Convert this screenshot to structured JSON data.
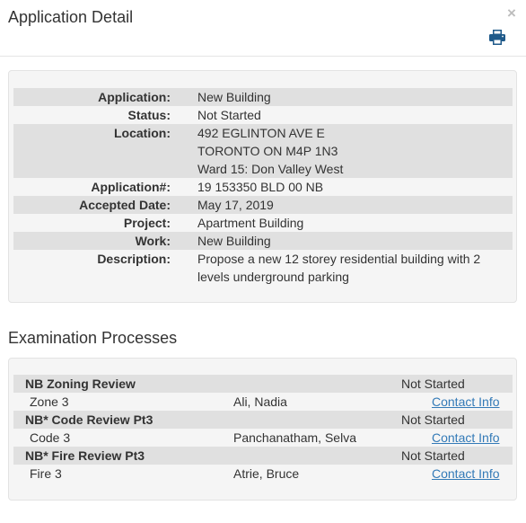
{
  "modal": {
    "title": "Application Detail",
    "close_glyph": "×",
    "print_icon": "print-icon",
    "close_icon": "close-icon"
  },
  "details": [
    {
      "label": "Application:",
      "value": "New Building"
    },
    {
      "label": "Status:",
      "value": "Not Started"
    },
    {
      "label": "Location:",
      "lines": [
        "492 EGLINTON AVE E",
        "TORONTO ON M4P 1N3",
        "Ward 15: Don Valley West"
      ]
    },
    {
      "label": "Application#:",
      "value": "19 153350 BLD 00 NB"
    },
    {
      "label": "Accepted Date:",
      "value": "May 17, 2019"
    },
    {
      "label": "Project:",
      "value": "Apartment Building"
    },
    {
      "label": "Work:",
      "value": "New Building"
    },
    {
      "label": "Description:",
      "lines": [
        "Propose a new 12 storey residential building with 2",
        "levels underground parking"
      ]
    }
  ],
  "examination": {
    "title": "Examination Processes",
    "processes": [
      {
        "name": "NB Zoning Review",
        "status": "Not Started",
        "code": "Zone 3",
        "examiner": "Ali, Nadia",
        "link": "Contact Info"
      },
      {
        "name": "NB* Code Review Pt3",
        "status": "Not Started",
        "code": "Code 3",
        "examiner": "Panchanatham, Selva",
        "link": "Contact Info"
      },
      {
        "name": "NB* Fire Review Pt3",
        "status": "Not Started",
        "code": "Fire 3",
        "examiner": "Atrie, Bruce",
        "link": "Contact Info"
      }
    ]
  },
  "colors": {
    "link": "#337ab7",
    "row_shade": "#e0e0e0",
    "well_bg": "#f5f5f5",
    "print_icon": "#1f5a8a"
  }
}
